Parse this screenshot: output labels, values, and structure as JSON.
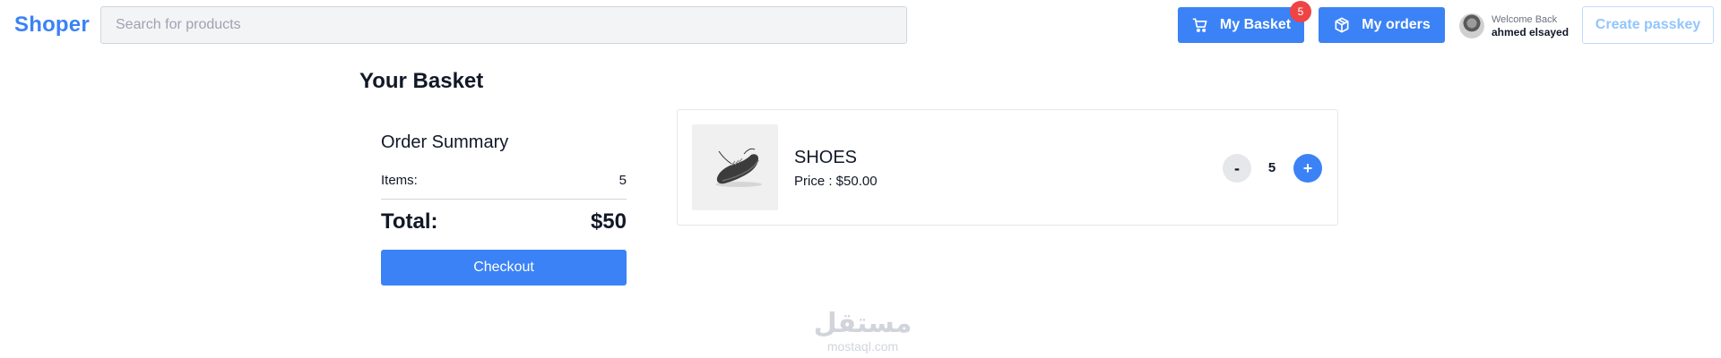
{
  "header": {
    "logo": "Shoper",
    "search_placeholder": "Search for products",
    "basket_label": "My Basket",
    "basket_count": "5",
    "orders_label": "My orders",
    "welcome": "Welcome Back",
    "username": "ahmed elsayed",
    "passkey_label": "Create passkey"
  },
  "page": {
    "title": "Your Basket"
  },
  "summary": {
    "title": "Order Summary",
    "items_label": "Items:",
    "items_value": "5",
    "total_label": "Total:",
    "total_value": "$50",
    "checkout_label": "Checkout"
  },
  "cart": {
    "items": [
      {
        "name": "SHOES",
        "price": "Price : $50.00",
        "minus": "-",
        "quantity": "5",
        "plus": "+"
      }
    ]
  },
  "watermark": {
    "arabic": "مستقل",
    "latin": "mostaql.com"
  },
  "colors": {
    "accent": "#3b82f6",
    "badge": "#ef4444",
    "passkey_text": "#93c5fd"
  },
  "icons": {
    "basket": "cart-icon",
    "orders": "box-icon"
  }
}
